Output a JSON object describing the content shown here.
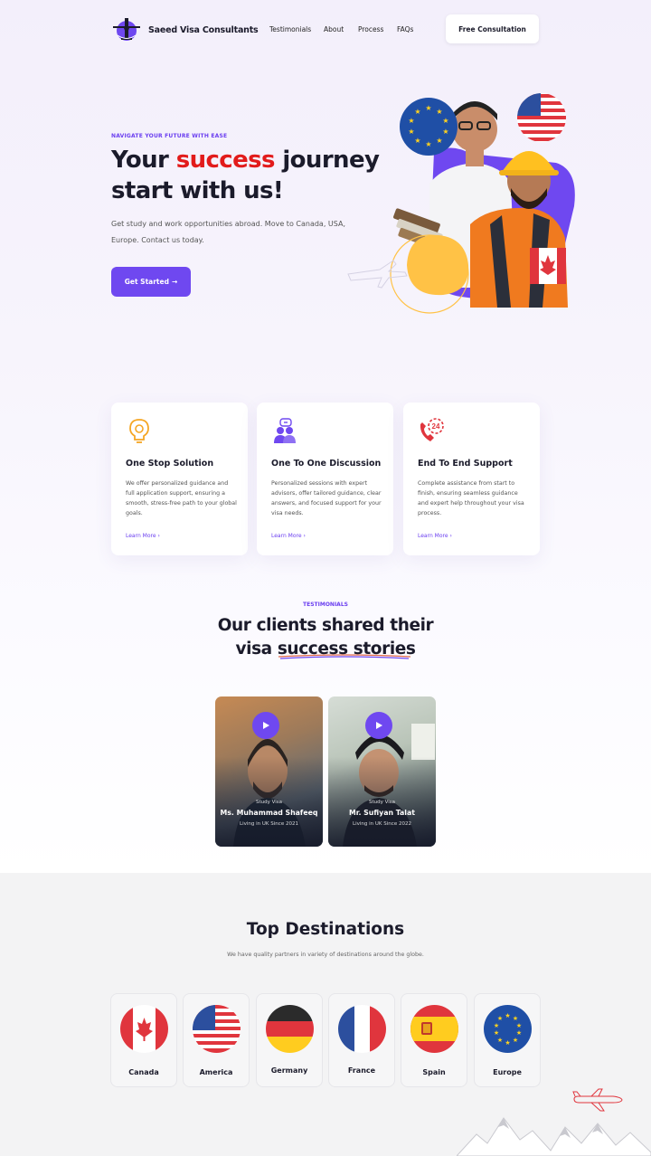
{
  "nav": {
    "brand": "Saeed Visa Consultants",
    "links": [
      "Testimonials",
      "About",
      "Process",
      "FAQs"
    ],
    "cta": "Free Consultation"
  },
  "hero": {
    "eyebrow": "NAVIGATE YOUR FUTURE WITH EASE",
    "title_pre": "Your ",
    "title_accent": "success",
    "title_post": " journey",
    "title_line2": "start with us!",
    "subtitle": "Get study and work opportunities abroad. Move to Canada, USA, Europe. Contact us today.",
    "button": "Get Started",
    "button_arrow": "→"
  },
  "features": [
    {
      "title": "One Stop Solution",
      "text": "We offer personalized guidance and full application support, ensuring a smooth, stress-free path to your global goals.",
      "link": "Learn More",
      "icon": "lightbulb-gear-icon"
    },
    {
      "title": "One To One Discussion",
      "text": "Personalized sessions with expert advisors, offer tailored guidance, clear answers, and focused support for your visa needs.",
      "link": "Learn More",
      "icon": "people-chat-icon"
    },
    {
      "title": "End To End Support",
      "text": "Complete assistance from start to finish, ensuring seamless guidance and expert help throughout your visa process.",
      "link": "Learn More",
      "icon": "phone-24-icon"
    }
  ],
  "link_arrow": "›",
  "testimonials": {
    "eyebrow": "TESTIMONIALS",
    "title_line1": "Our clients shared their",
    "title_line2_pre": "visa ",
    "title_line2_accent": "success stories",
    "videos": [
      {
        "type": "Study Visa",
        "name": "Ms. Muhammad Shafeeq",
        "since": "Living in UK Since 2021"
      },
      {
        "type": "Study Visa",
        "name": "Mr. Sufiyan Talat",
        "since": "Living in UK Since 2022"
      }
    ]
  },
  "destinations": {
    "title": "Top Destinations",
    "subtitle": "We have quality partners in variety of destinations around the globe.",
    "items": [
      {
        "name": "Canada",
        "flag": "canada-flag"
      },
      {
        "name": "America",
        "flag": "usa-flag"
      },
      {
        "name": "Germany",
        "flag": "germany-flag"
      },
      {
        "name": "France",
        "flag": "france-flag"
      },
      {
        "name": "Spain",
        "flag": "spain-flag"
      },
      {
        "name": "Europe",
        "flag": "eu-flag"
      }
    ]
  },
  "colors": {
    "primary": "#6f48f0",
    "accent_red": "#e21b1b",
    "yellow": "#ffc246",
    "dark": "#1b1b2b"
  }
}
